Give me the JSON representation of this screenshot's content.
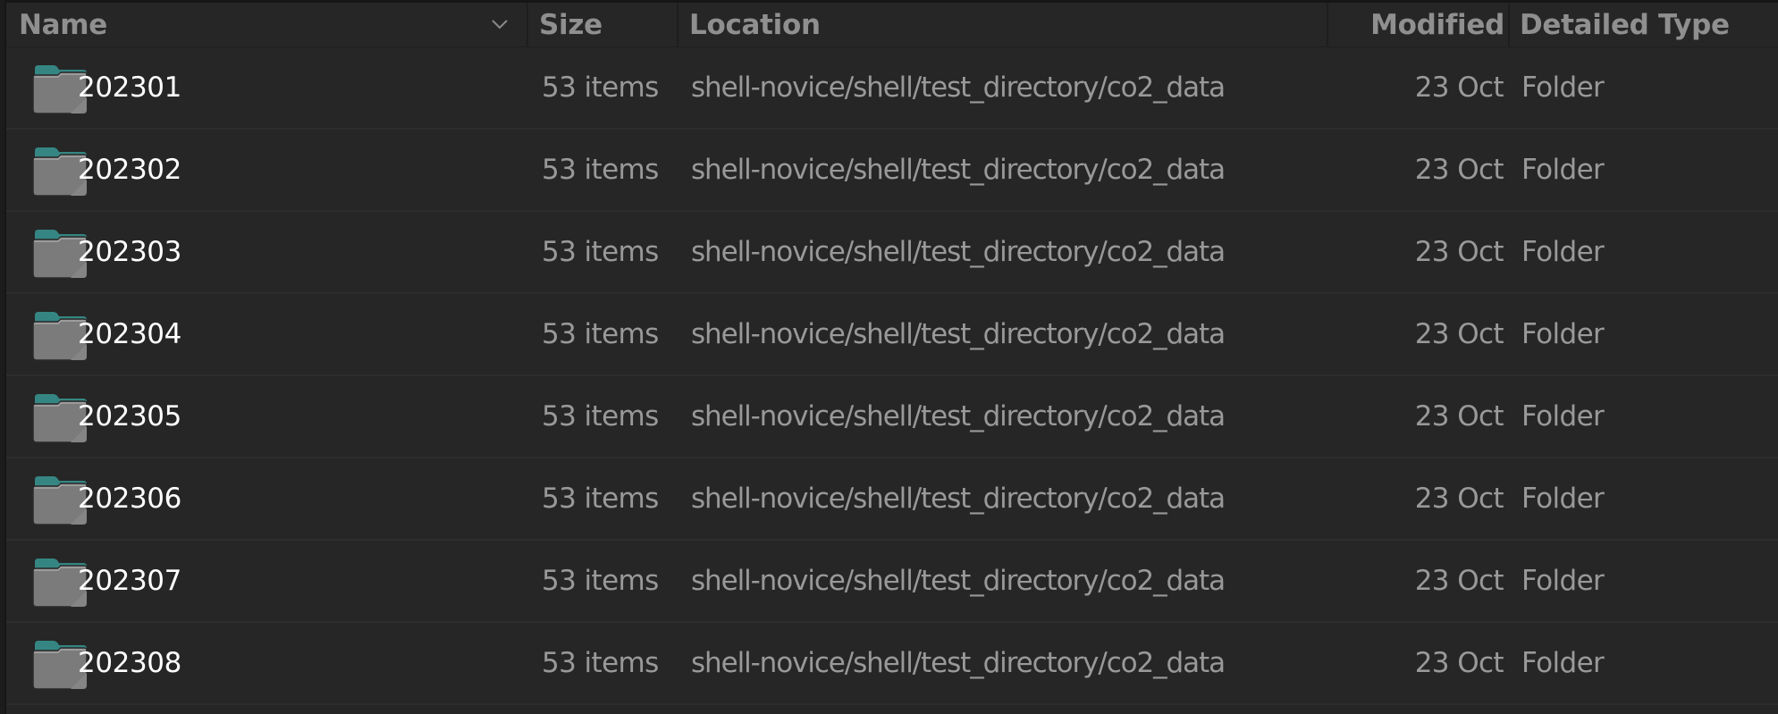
{
  "columns": {
    "name": "Name",
    "size": "Size",
    "location": "Location",
    "modified": "Modified",
    "detailed_type": "Detailed Type"
  },
  "sort": {
    "column": "name",
    "icon": "chevron-down-icon"
  },
  "colors": {
    "background": "#262626",
    "header_text": "#8f8f8f",
    "name_text": "#ffffff",
    "secondary_text": "#999999",
    "folder_tab": "#2f7b78",
    "folder_body": "#7b7b7b"
  },
  "rows": [
    {
      "icon": "folder-icon",
      "name": "202301",
      "size": "53 items",
      "location": "shell-novice/shell/test_directory/co2_data",
      "modified": "23 Oct",
      "detailed_type": "Folder"
    },
    {
      "icon": "folder-icon",
      "name": "202302",
      "size": "53 items",
      "location": "shell-novice/shell/test_directory/co2_data",
      "modified": "23 Oct",
      "detailed_type": "Folder"
    },
    {
      "icon": "folder-icon",
      "name": "202303",
      "size": "53 items",
      "location": "shell-novice/shell/test_directory/co2_data",
      "modified": "23 Oct",
      "detailed_type": "Folder"
    },
    {
      "icon": "folder-icon",
      "name": "202304",
      "size": "53 items",
      "location": "shell-novice/shell/test_directory/co2_data",
      "modified": "23 Oct",
      "detailed_type": "Folder"
    },
    {
      "icon": "folder-icon",
      "name": "202305",
      "size": "53 items",
      "location": "shell-novice/shell/test_directory/co2_data",
      "modified": "23 Oct",
      "detailed_type": "Folder"
    },
    {
      "icon": "folder-icon",
      "name": "202306",
      "size": "53 items",
      "location": "shell-novice/shell/test_directory/co2_data",
      "modified": "23 Oct",
      "detailed_type": "Folder"
    },
    {
      "icon": "folder-icon",
      "name": "202307",
      "size": "53 items",
      "location": "shell-novice/shell/test_directory/co2_data",
      "modified": "23 Oct",
      "detailed_type": "Folder"
    },
    {
      "icon": "folder-icon",
      "name": "202308",
      "size": "53 items",
      "location": "shell-novice/shell/test_directory/co2_data",
      "modified": "23 Oct",
      "detailed_type": "Folder"
    }
  ]
}
